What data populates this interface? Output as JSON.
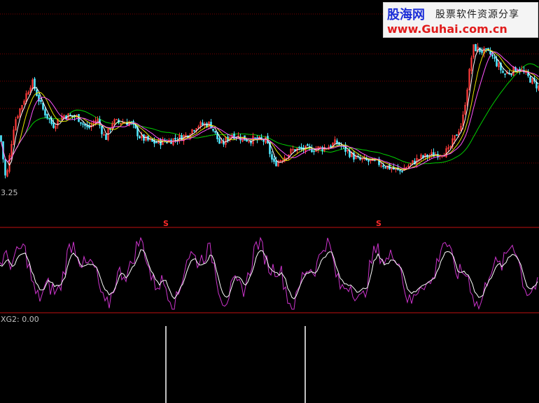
{
  "watermark": {
    "brand": "股海网",
    "slogan": "股票软件资源分享",
    "url": "www.Guhai.com.cn"
  },
  "labels": {
    "low_price": "3.25",
    "indicator": "XG2: 0.00",
    "signal_1": "S",
    "signal_2": "S"
  },
  "colors": {
    "background": "#000000",
    "separator": "#c01010",
    "grid": "#7a0000",
    "up_candle": "#ff3b3b",
    "down_candle": "#50e8ff",
    "ma_short": "#ffffff",
    "ma_mid": "#e5e500",
    "ma_mid2": "#ff55ff",
    "ma_long": "#00d000",
    "oscillator": "#cc33cc",
    "oscillator_signal": "#ffffff",
    "signal_bar": "#ffffff"
  },
  "chart_data": [
    {
      "type": "candlestick",
      "title": "",
      "price_keypoints": [
        [
          0,
          4.6
        ],
        [
          8,
          3.25
        ],
        [
          20,
          5.0
        ],
        [
          45,
          6.2
        ],
        [
          60,
          5.4
        ],
        [
          75,
          4.9
        ],
        [
          90,
          5.2
        ],
        [
          110,
          5.15
        ],
        [
          125,
          4.8
        ],
        [
          138,
          5.1
        ],
        [
          150,
          4.5
        ],
        [
          160,
          5.0
        ],
        [
          185,
          5.0
        ],
        [
          200,
          4.55
        ],
        [
          218,
          4.4
        ],
        [
          240,
          4.45
        ],
        [
          265,
          4.6
        ],
        [
          280,
          4.9
        ],
        [
          300,
          4.95
        ],
        [
          315,
          4.3
        ],
        [
          330,
          4.65
        ],
        [
          350,
          4.5
        ],
        [
          380,
          4.45
        ],
        [
          390,
          3.75
        ],
        [
          420,
          4.2
        ],
        [
          440,
          4.2
        ],
        [
          465,
          4.25
        ],
        [
          480,
          4.4
        ],
        [
          510,
          3.9
        ],
        [
          540,
          3.8
        ],
        [
          570,
          3.55
        ],
        [
          600,
          3.95
        ],
        [
          640,
          4.15
        ],
        [
          660,
          5.0
        ],
        [
          675,
          7.2
        ],
        [
          700,
          7.0
        ],
        [
          720,
          6.4
        ],
        [
          740,
          6.6
        ],
        [
          770,
          6.0
        ]
      ],
      "annotations": [
        "3.25"
      ]
    },
    {
      "type": "line",
      "series": [
        {
          "values": "oscillator (magenta)"
        },
        {
          "values": "signal line (white)"
        }
      ],
      "signal_markers": [
        237,
        541
      ]
    },
    {
      "type": "bar",
      "title": "XG2: 0.00",
      "bars": [
        {
          "x": 237,
          "value": 1
        },
        {
          "x": 436,
          "value": 1
        }
      ]
    }
  ]
}
